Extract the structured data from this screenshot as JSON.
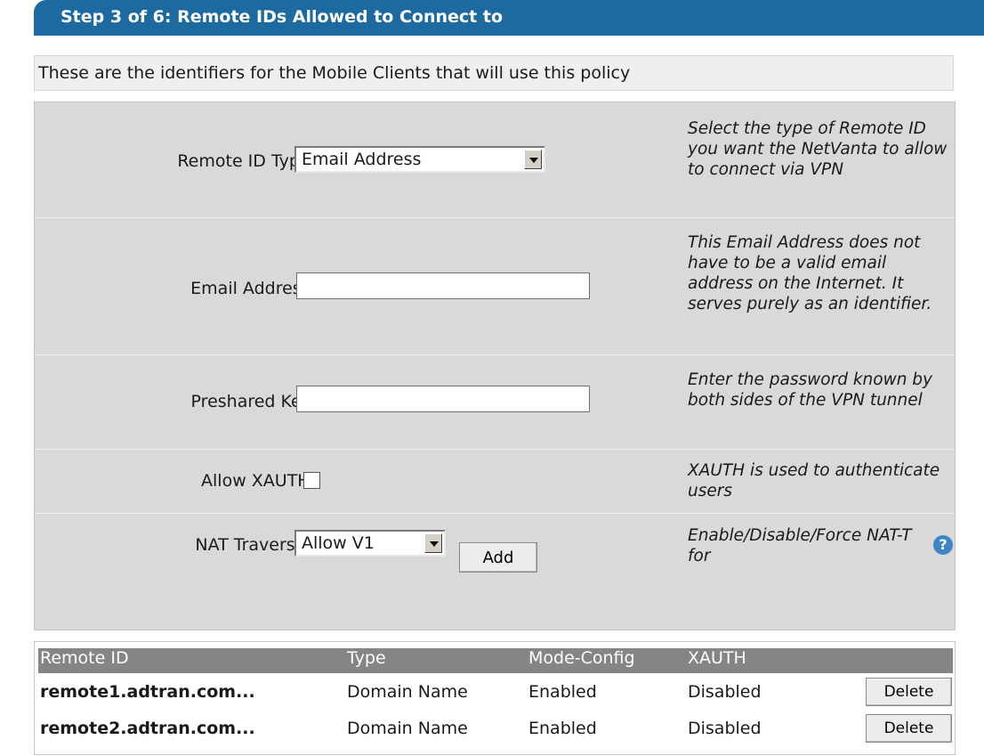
{
  "header": {
    "title": "Step 3 of 6: Remote IDs Allowed to Connect to"
  },
  "intro": "These are the identifiers for the Mobile Clients that will use this policy",
  "form": {
    "remote_id_type": {
      "label": "Remote ID Type:",
      "value": "Email Address",
      "hint": "Select the type of Remote ID you want the NetVanta to allow to connect via VPN"
    },
    "email": {
      "label": "Email Address:",
      "value": "",
      "hint": "This Email Address does not have to be a valid email address on the Internet. It serves purely as an identifier."
    },
    "psk": {
      "label": "Preshared Key:",
      "value": "",
      "hint": "Enter the password known by both sides of the VPN tunnel"
    },
    "xauth": {
      "label": "Allow XAUTH:",
      "checked": false,
      "hint": "XAUTH is used to authenticate users"
    },
    "nat": {
      "label": "NAT Traversal:",
      "value": "Allow V1",
      "hint": "Enable/Disable/Force NAT-T for"
    },
    "add_label": "Add"
  },
  "table": {
    "headers": [
      "Remote ID",
      "Type",
      "Mode-Config",
      "XAUTH"
    ],
    "rows": [
      {
        "remote_id": "remote1.adtran.com...",
        "type": "Domain Name",
        "mode_config": "Enabled",
        "xauth": "Disabled",
        "action": "Delete"
      },
      {
        "remote_id": "remote2.adtran.com...",
        "type": "Domain Name",
        "mode_config": "Enabled",
        "xauth": "Disabled",
        "action": "Delete"
      }
    ]
  },
  "colors": {
    "header_bg": "#1d6aa0",
    "form_bg": "#d9d9d9",
    "table_header_bg": "#858585",
    "help_icon": "#3d86c6"
  }
}
